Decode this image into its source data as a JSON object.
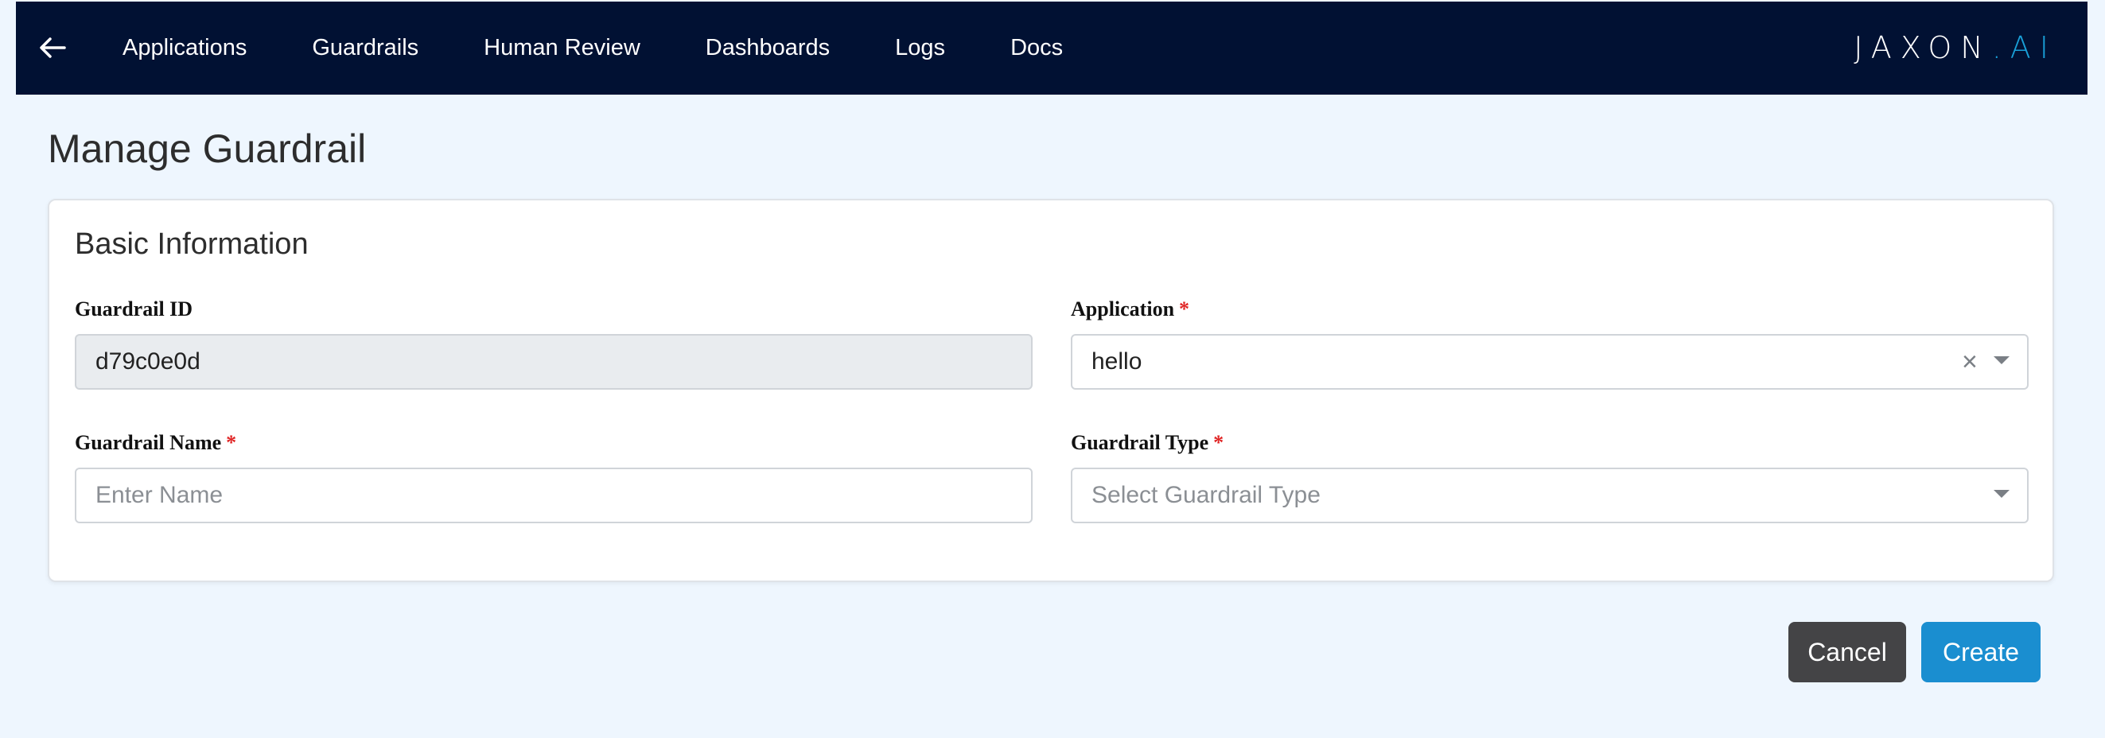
{
  "nav": {
    "back_icon": "arrow-left-icon",
    "links": [
      "Applications",
      "Guardrails",
      "Human Review",
      "Dashboards",
      "Logs",
      "Docs"
    ],
    "logo_main": "JAXON",
    "logo_suffix": ".AI"
  },
  "page": {
    "title": "Manage Guardrail"
  },
  "card": {
    "title": "Basic Information",
    "guardrail_id": {
      "label": "Guardrail ID",
      "value": "d79c0e0d"
    },
    "application": {
      "label": "Application",
      "required": "*",
      "value": "hello"
    },
    "guardrail_name": {
      "label": "Guardrail Name",
      "required": "*",
      "placeholder": "Enter Name"
    },
    "guardrail_type": {
      "label": "Guardrail Type",
      "required": "*",
      "placeholder": "Select Guardrail Type"
    }
  },
  "actions": {
    "cancel_label": "Cancel",
    "create_label": "Create"
  },
  "colors": {
    "navbar": "#011133",
    "accent": "#1a8ed0",
    "cancel": "#444446",
    "required": "#e02424"
  }
}
